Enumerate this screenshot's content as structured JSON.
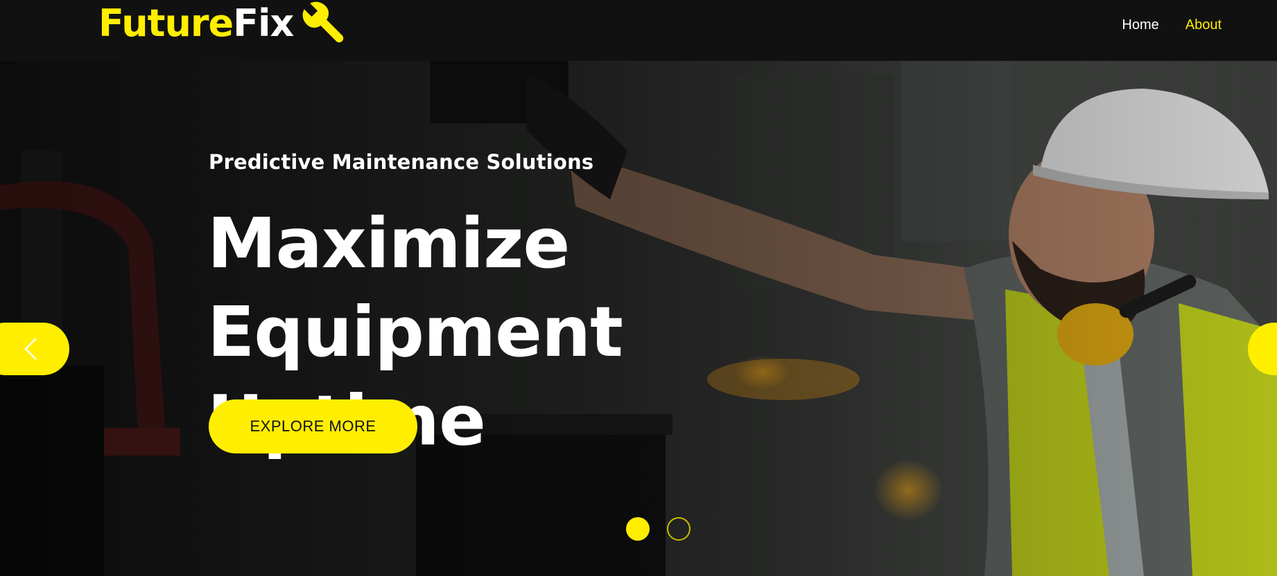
{
  "brand": {
    "name_part1": "Future",
    "name_part2": "Fix",
    "logo_icon": "wrench-icon",
    "accent_color": "#ffee00"
  },
  "nav": {
    "links": [
      {
        "label": "Home",
        "active": false
      },
      {
        "label": "About",
        "active": true
      }
    ]
  },
  "hero": {
    "subtitle": "Predictive Maintenance Solutions",
    "title_line1": "Maximize Equipment",
    "title_line2": "Uptime",
    "cta_label": "EXPLORE MORE",
    "prev_icon": "chevron-left-icon",
    "next_icon": "chevron-right-icon",
    "slides": [
      {
        "active": true
      },
      {
        "active": false
      }
    ]
  }
}
